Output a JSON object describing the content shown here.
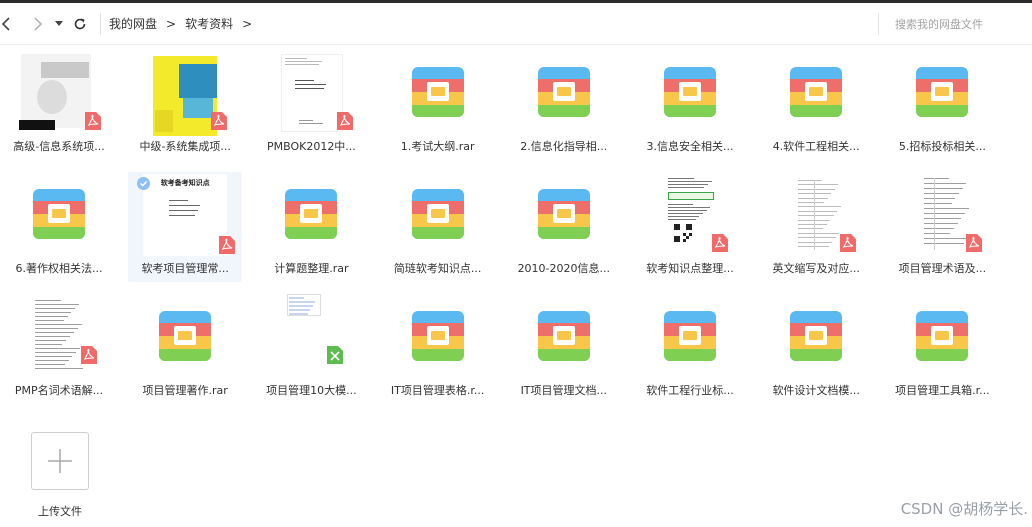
{
  "breadcrumb": {
    "root": "我的网盘",
    "current": "软考资料",
    "sep": ">"
  },
  "search": {
    "placeholder": "搜索我的网盘文件"
  },
  "files": [
    {
      "name": "高级-信息系统项...",
      "kind": "pdf-cover-a"
    },
    {
      "name": "中级-系统集成项...",
      "kind": "pdf-cover-b"
    },
    {
      "name": "PMBOK2012中...",
      "kind": "pdf-cover-c"
    },
    {
      "name": "1.考试大纲.rar",
      "kind": "rar"
    },
    {
      "name": "2.信息化指导相...",
      "kind": "rar"
    },
    {
      "name": "3.信息安全相关...",
      "kind": "rar"
    },
    {
      "name": "4.软件工程相关...",
      "kind": "rar"
    },
    {
      "name": "5.招标投标相关...",
      "kind": "rar"
    },
    {
      "name": "6.著作权相关法...",
      "kind": "rar"
    },
    {
      "name": "软考项目管理常...",
      "kind": "pdf-doc-selected",
      "doc_title": "软考备考知识点"
    },
    {
      "name": "计算题整理.rar",
      "kind": "rar"
    },
    {
      "name": "简琏软考知识点...",
      "kind": "rar"
    },
    {
      "name": "2010-2020信息...",
      "kind": "rar"
    },
    {
      "name": "软考知识点整理...",
      "kind": "pdf-doc-qr"
    },
    {
      "name": "英文缩写及对应...",
      "kind": "pdf-doc-table"
    },
    {
      "name": "项目管理术语及...",
      "kind": "pdf-doc-table2"
    },
    {
      "name": "PMP名词术语解...",
      "kind": "pdf-doc-text"
    },
    {
      "name": "项目管理著作.rar",
      "kind": "rar"
    },
    {
      "name": "项目管理10大模...",
      "kind": "xls"
    },
    {
      "name": "IT项目管理表格.r...",
      "kind": "rar"
    },
    {
      "name": "IT项目管理文档...",
      "kind": "rar"
    },
    {
      "name": "软件工程行业标...",
      "kind": "rar"
    },
    {
      "name": "软件设计文档模...",
      "kind": "rar"
    },
    {
      "name": "项目管理工具箱.r...",
      "kind": "rar"
    }
  ],
  "upload": {
    "label": "上传文件"
  },
  "watermark": "CSDN @胡杨学长.",
  "colors": {
    "rar_blue": "#5ab9f1",
    "rar_red": "#ee6f6a",
    "rar_yellow": "#f8c74a",
    "rar_green": "#7fcf52",
    "pdf_red": "#f06a6a",
    "xls_green": "#5dbb4f",
    "selected_bg": "#f1f6fd"
  }
}
